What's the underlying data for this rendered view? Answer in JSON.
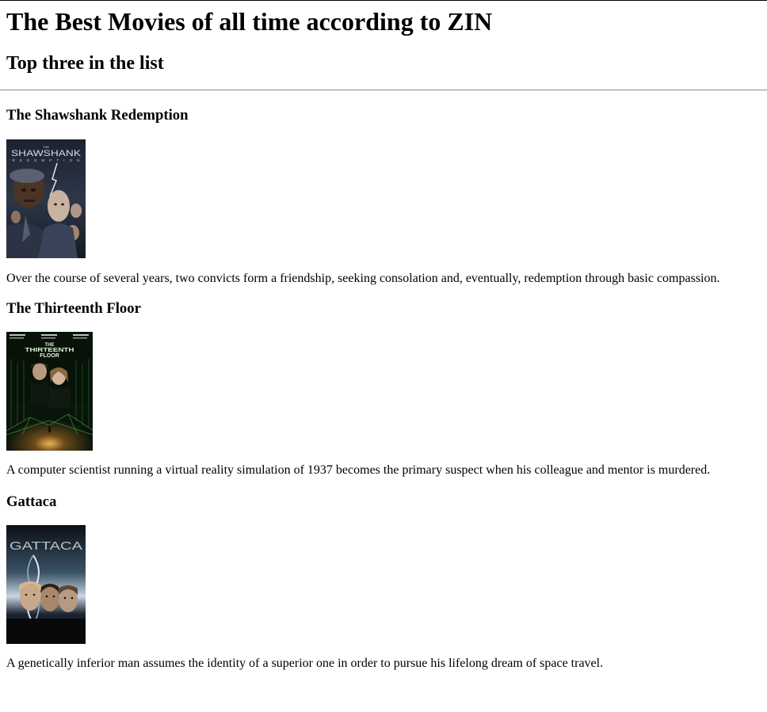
{
  "page": {
    "title": "The Best Movies of all time according to ZIN",
    "subtitle": "Top three in the list"
  },
  "movies": [
    {
      "title": "The Shawshank Redemption",
      "poster_text_top": "THE",
      "poster_text_main": "SHAWSHANK",
      "poster_text_sub": "REDEMPTION",
      "description": "Over the course of several years, two convicts form a friendship, seeking consolation and, eventually, redemption through basic compassion."
    },
    {
      "title": "The Thirteenth Floor",
      "poster_text_top": "THE",
      "poster_text_main": "THIRTEENTH",
      "poster_text_sub": "FLOOR",
      "description": "A computer scientist running a virtual reality simulation of 1937 becomes the primary suspect when his colleague and mentor is murdered."
    },
    {
      "title": "Gattaca",
      "poster_text_main": "GATTACA",
      "description": "A genetically inferior man assumes the identity of a superior one in order to pursue his lifelong dream of space travel."
    }
  ]
}
